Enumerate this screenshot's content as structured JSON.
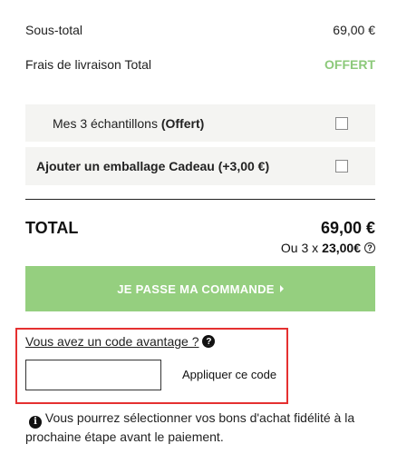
{
  "summary": {
    "subtotal_label": "Sous-total",
    "subtotal_value": "69,00 €",
    "shipping_label": "Frais de livraison Total",
    "shipping_value": "OFFERT",
    "shipping_value_color": "#8cc97a"
  },
  "options": {
    "samples_label": "Mes 3 échantillons",
    "samples_note": "(Offert)",
    "samples_checked": false,
    "gift_label": "Ajouter un emballage Cadeau (+3,00 €)",
    "gift_checked": false
  },
  "total": {
    "label": "TOTAL",
    "value": "69,00 €",
    "installments_prefix": "Ou 3 x",
    "installments_value": "23,00€",
    "help_icon": "question-circle-icon"
  },
  "checkout": {
    "label": "JE PASSE MA COMMANDE",
    "color": "#95cf7f",
    "icon": "caret-right-icon"
  },
  "promo": {
    "question": "Vous avez un code avantage ?",
    "help_icon": "question-dot-icon",
    "input_value": "",
    "input_placeholder": "",
    "apply_label": "Appliquer ce code",
    "highlight_color": "#e53030"
  },
  "loyalty": {
    "icon": "info-icon",
    "note": "Vous pourrez sélectionner vos bons d'achat fidélité à la prochaine étape avant le paiement."
  }
}
